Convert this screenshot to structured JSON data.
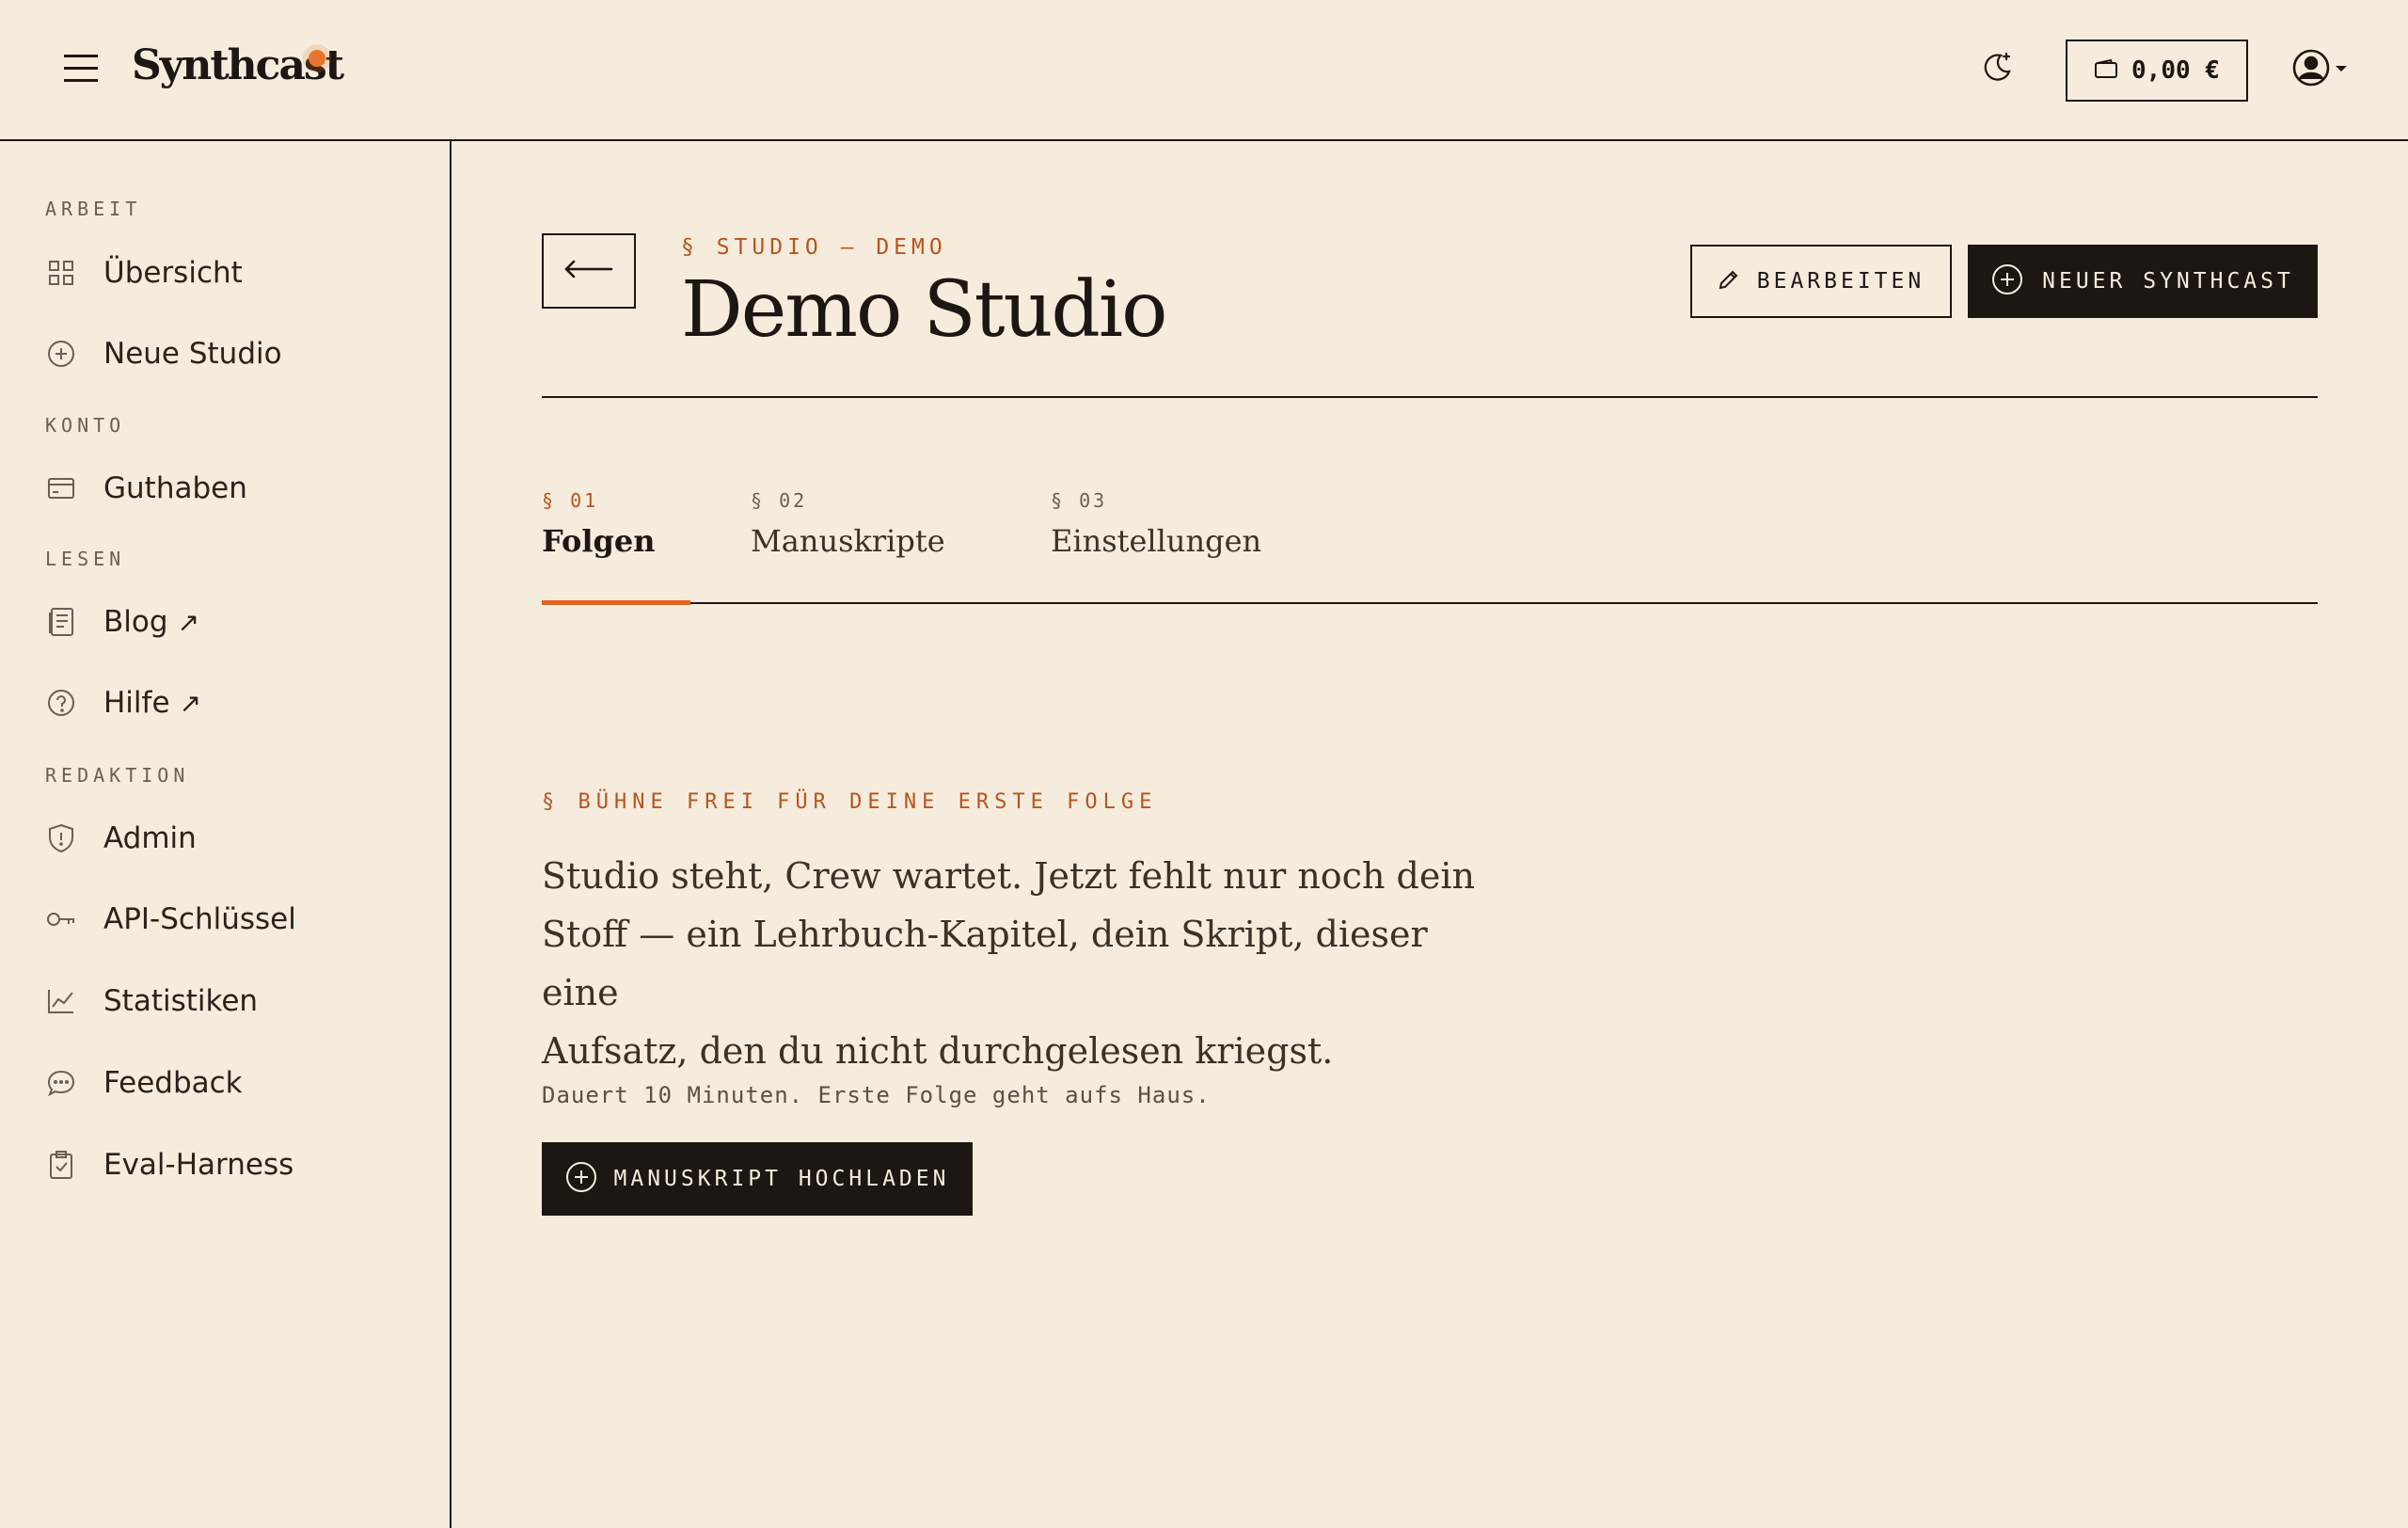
{
  "header": {
    "logo_text": "Synthcast",
    "wallet_amount": "0,00 €",
    "icons": [
      "menu-icon",
      "moon-icon",
      "wallet-icon",
      "user-icon",
      "caret-down-icon"
    ],
    "accent_color": "#e8742e"
  },
  "sidebar": {
    "sections": [
      {
        "label": "ARBEIT",
        "items": [
          {
            "label": "Übersicht",
            "icon": "grid-icon",
            "external": ""
          },
          {
            "label": "Neue Studio",
            "icon": "plus-circle-icon",
            "external": ""
          }
        ]
      },
      {
        "label": "KONTO",
        "items": [
          {
            "label": "Guthaben",
            "icon": "credit-card-icon",
            "external": ""
          }
        ]
      },
      {
        "label": "LESEN",
        "items": [
          {
            "label": "Blog",
            "icon": "document-icon",
            "external": "↗"
          },
          {
            "label": "Hilfe",
            "icon": "help-icon",
            "external": "↗"
          }
        ]
      },
      {
        "label": "REDAKTION",
        "items": [
          {
            "label": "Admin",
            "icon": "shield-icon",
            "external": ""
          },
          {
            "label": "API-Schlüssel",
            "icon": "key-icon",
            "external": ""
          },
          {
            "label": "Statistiken",
            "icon": "chart-icon",
            "external": ""
          },
          {
            "label": "Feedback",
            "icon": "chat-icon",
            "external": ""
          },
          {
            "label": "Eval-Harness",
            "icon": "clipboard-icon",
            "external": ""
          }
        ]
      }
    ]
  },
  "page": {
    "eyebrow": "§ STUDIO — DEMO",
    "title": "Demo Studio",
    "edit_label": "BEARBEITEN",
    "new_label": "NEUER SYNTHCAST"
  },
  "tabs": [
    {
      "num": "§ 01",
      "label": "Folgen",
      "active": true
    },
    {
      "num": "§ 02",
      "label": "Manuskripte",
      "active": false
    },
    {
      "num": "§ 03",
      "label": "Einstellungen",
      "active": false
    }
  ],
  "empty_state": {
    "eyebrow": "§ BÜHNE FREI FÜR DEINE ERSTE FOLGE",
    "lead_lines": [
      "Studio steht, Crew wartet. Jetzt fehlt nur noch dein",
      "Stoff — ein Lehrbuch-Kapitel, dein Skript, dieser eine",
      "Aufsatz, den du nicht durchgelesen kriegst."
    ],
    "note": "Dauert 10 Minuten. Erste Folge geht aufs Haus.",
    "upload_label": "MANUSKRIPT HOCHLADEN"
  }
}
